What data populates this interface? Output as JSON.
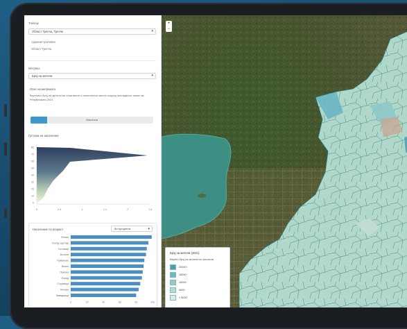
{
  "sidebar": {
    "region_label": "Trebinje",
    "region_select": "Област Трепча, Трепче",
    "sub_label": "Административни",
    "sub_value": "Област Трепча",
    "metric_label": "Метрика",
    "metric_select": "Броj на жители",
    "desc_title": "Опис на метриката",
    "desc_text": "Вкупниот број на жители во општините и населените места според последниот попис во Републиката 2021",
    "toggle_label": "Општини",
    "chart_title": "Густина на население",
    "bar_section_title": "Население по возраст",
    "bar_select": "Во проценти",
    "pyramid": {
      "y_ticks": [
        "80",
        "70",
        "60",
        "50",
        "40",
        "30",
        "20",
        "10",
        "0"
      ],
      "x_ticks": [
        "0",
        "0.4",
        "1",
        "1.4",
        "2",
        "2.4"
      ]
    },
    "bars": {
      "categories": [
        "Тетово",
        "Скопје Центар",
        "Гостивар",
        "Битола",
        "Kумaнoвo",
        "Велес",
        "Прилеп",
        "Охрид",
        "Струмица",
        "Кичево",
        "Кавадарци"
      ],
      "values": [
        99,
        95,
        93,
        92,
        90,
        89,
        88,
        87,
        85,
        83,
        80
      ],
      "x_ticks": [
        "0",
        "20",
        "40",
        "60",
        "80",
        "100"
      ]
    }
  },
  "map": {
    "zoom_in": "+",
    "zoom_out": "−",
    "legend_title": "Број на жители (2021)",
    "legend_subtitle": "Вкупен број на жители по општина",
    "legend_items": [
      {
        "label": "20000",
        "color": "#4a9fb5"
      },
      {
        "label": "15000",
        "color": "#6fb8c0"
      },
      {
        "label": "10000",
        "color": "#91ccc8"
      },
      {
        "label": "5000",
        "color": "#b3ded6"
      },
      {
        "label": "< 5000",
        "color": "#d4ede6"
      }
    ]
  },
  "colors": {
    "accent": "#3d9ac8",
    "bar": "#4b8fc0"
  }
}
